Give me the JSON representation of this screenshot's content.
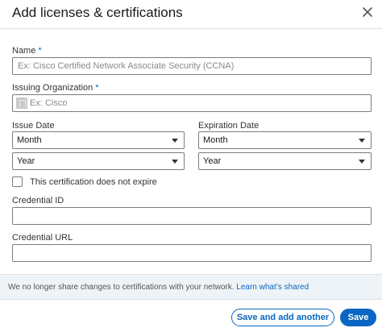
{
  "dialog": {
    "title": "Add licenses & certifications",
    "close_icon": "close-icon"
  },
  "form": {
    "name": {
      "label": "Name",
      "required_mark": "*",
      "value": "",
      "placeholder": "Ex: Cisco Certified Network Associate Security (CCNA)"
    },
    "issuing_org": {
      "label": "Issuing Organization",
      "required_mark": "*",
      "value": "",
      "placeholder": "Ex: Cisco",
      "icon": "company-logo-placeholder-icon"
    },
    "issue_date": {
      "label": "Issue Date",
      "month": "Month",
      "year": "Year"
    },
    "expiration_date": {
      "label": "Expiration Date",
      "month": "Month",
      "year": "Year"
    },
    "no_expire": {
      "label": "This certification does not expire",
      "checked": false
    },
    "credential_id": {
      "label": "Credential ID",
      "value": ""
    },
    "credential_url": {
      "label": "Credential URL",
      "value": ""
    }
  },
  "notice": {
    "text": "We no longer share changes to certifications with your network. ",
    "link": "Learn what’s shared"
  },
  "footer": {
    "save_and_add_label": "Save and add another",
    "save_label": "Save"
  },
  "colors": {
    "accent": "#0a66c2",
    "notice_bg": "#eef3f8"
  }
}
